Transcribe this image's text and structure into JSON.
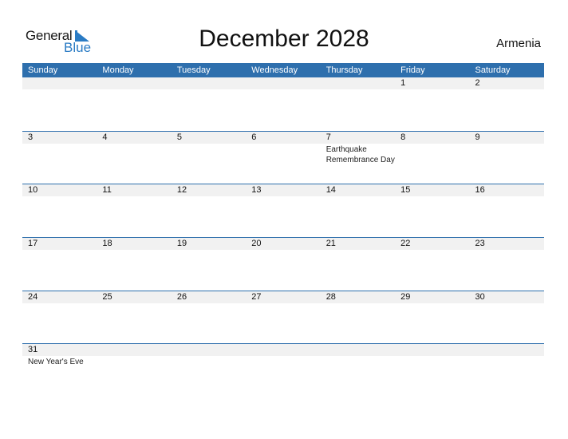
{
  "logo": {
    "word1": "General",
    "word2": "Blue"
  },
  "title": "December 2028",
  "country": "Armenia",
  "colors": {
    "accent": "#2e6fad",
    "brand_blue": "#2a7bc4",
    "date_row_bg": "#f1f1f1"
  },
  "weekdays": [
    "Sunday",
    "Monday",
    "Tuesday",
    "Wednesday",
    "Thursday",
    "Friday",
    "Saturday"
  ],
  "weeks": [
    {
      "days": [
        "",
        "",
        "",
        "",
        "",
        "1",
        "2"
      ],
      "events": [
        "",
        "",
        "",
        "",
        "",
        "",
        ""
      ]
    },
    {
      "days": [
        "3",
        "4",
        "5",
        "6",
        "7",
        "8",
        "9"
      ],
      "events": [
        "",
        "",
        "",
        "",
        "Earthquake Remembrance Day",
        "",
        ""
      ]
    },
    {
      "days": [
        "10",
        "11",
        "12",
        "13",
        "14",
        "15",
        "16"
      ],
      "events": [
        "",
        "",
        "",
        "",
        "",
        "",
        ""
      ]
    },
    {
      "days": [
        "17",
        "18",
        "19",
        "20",
        "21",
        "22",
        "23"
      ],
      "events": [
        "",
        "",
        "",
        "",
        "",
        "",
        ""
      ]
    },
    {
      "days": [
        "24",
        "25",
        "26",
        "27",
        "28",
        "29",
        "30"
      ],
      "events": [
        "",
        "",
        "",
        "",
        "",
        "",
        ""
      ]
    },
    {
      "days": [
        "31",
        "",
        "",
        "",
        "",
        "",
        ""
      ],
      "events": [
        "New Year's Eve",
        "",
        "",
        "",
        "",
        "",
        ""
      ]
    }
  ]
}
